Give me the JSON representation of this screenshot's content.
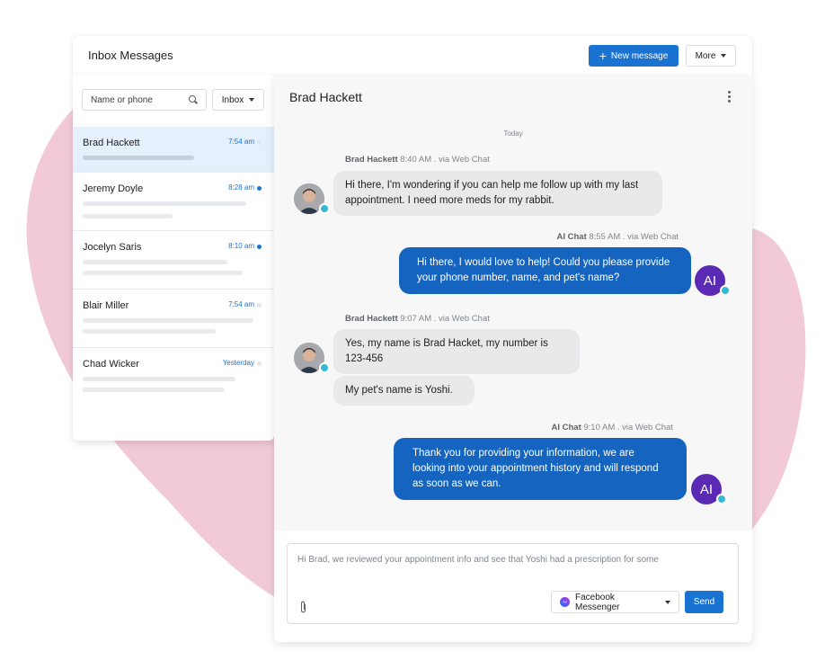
{
  "header": {
    "title": "Inbox Messages",
    "new_message": "New message",
    "more": "More"
  },
  "sidebar": {
    "search_placeholder": "Name or phone",
    "filter": "Inbox",
    "conversations": [
      {
        "name": "Brad Hackett",
        "time": "7:54 am",
        "unread": false
      },
      {
        "name": "Jeremy Doyle",
        "time": "8:28 am",
        "unread": true
      },
      {
        "name": "Jocelyn Saris",
        "time": "8:10 am",
        "unread": true
      },
      {
        "name": "Blair Miller",
        "time": "7:54 am",
        "unread": false
      },
      {
        "name": "Chad Wicker",
        "time": "Yesterday",
        "unread": false
      }
    ]
  },
  "chat": {
    "title": "Brad Hackett",
    "day": "Today",
    "messages": [
      {
        "sender": "Brad Hackett",
        "meta": "8:40 AM . via Web Chat",
        "texts": [
          "Hi there, I'm wondering if you can help me follow up with my last appointment. I need more meds for my rabbit."
        ]
      },
      {
        "sender": "AI Chat",
        "meta": "8:55 AM . via Web Chat",
        "avatar": "AI",
        "texts": [
          "Hi there, I would love to help! Could you please provide your phone number, name, and pet's name?"
        ]
      },
      {
        "sender": "Brad Hackett",
        "meta": "9:07 AM . via Web Chat",
        "texts": [
          "Yes, my name is Brad Hacket, my number is 123-456",
          "My pet's name is Yoshi."
        ]
      },
      {
        "sender": "AI Chat",
        "meta": "9:10 AM . via Web Chat",
        "avatar": "AI",
        "texts": [
          "Thank you for providing your information, we are looking into your appointment history and will respond as soon as we can."
        ]
      }
    ]
  },
  "composer": {
    "draft": "Hi Brad, we reviewed your appointment info and see that Yoshi had a prescription for some",
    "channel": "Facebook Messenger",
    "send": "Send"
  },
  "colors": {
    "primary": "#1a73d1",
    "outgoing_bubble": "#1565c0",
    "ai_avatar": "#5b2ab4",
    "background_blob": "#f2cad7"
  }
}
